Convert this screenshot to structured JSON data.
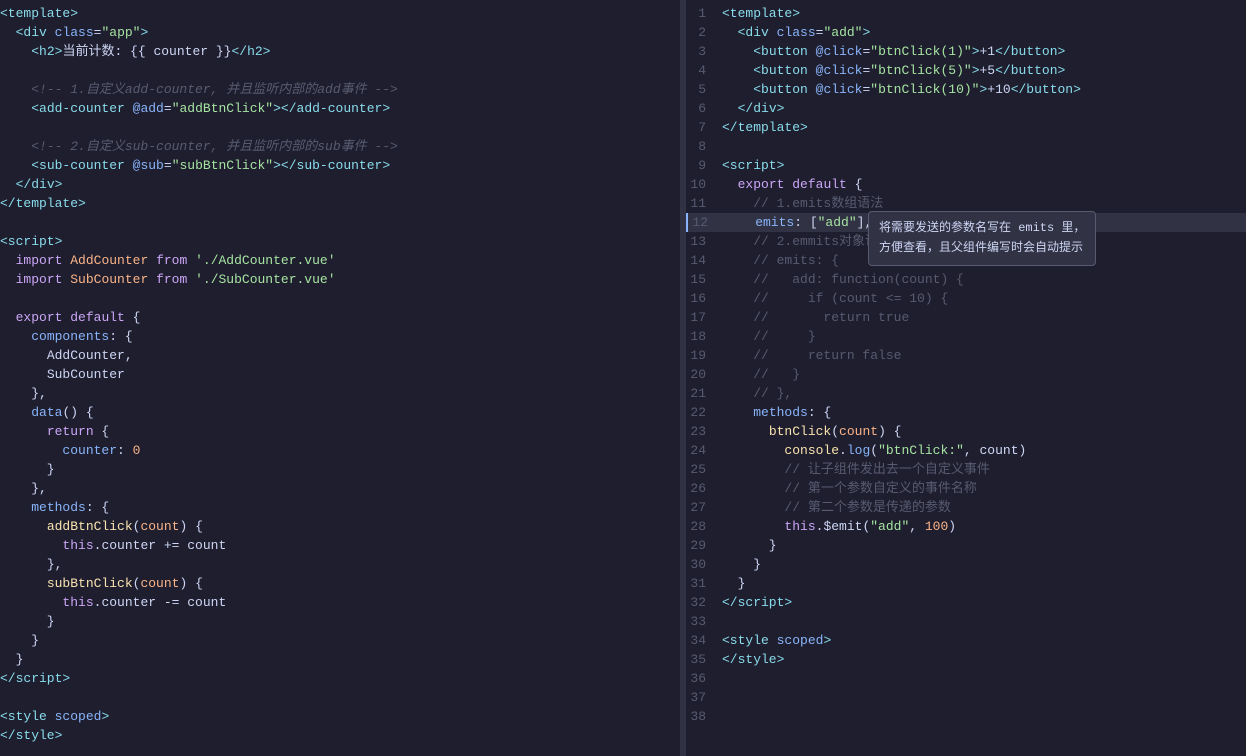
{
  "left_pane": {
    "lines": [
      {
        "num": "",
        "content": "<template>",
        "tokens": [
          {
            "t": "tag",
            "v": "<template>"
          }
        ]
      },
      {
        "num": "",
        "content": "  <div class=\"app\">",
        "tokens": [
          {
            "t": "tag",
            "v": "  <div"
          },
          {
            "t": "white",
            "v": " "
          },
          {
            "t": "attr",
            "v": "class"
          },
          {
            "t": "white",
            "v": "="
          },
          {
            "t": "string",
            "v": "\"app\""
          },
          {
            "t": "tag",
            "v": ">"
          }
        ]
      },
      {
        "num": "",
        "content": "    <h2>当前计数: {{ counter }}</h2>",
        "tokens": [
          {
            "t": "tag",
            "v": "    <h2>"
          },
          {
            "t": "white",
            "v": "当前计数: {{ counter }}"
          },
          {
            "t": "tag",
            "v": "</h2>"
          }
        ]
      },
      {
        "num": "",
        "content": "",
        "tokens": []
      },
      {
        "num": "",
        "content": "    <!-- 1.自定义add-counter, 并且监听内部的add事件 -->",
        "tokens": [
          {
            "t": "comment",
            "v": "    <!-- 1.自定义add-counter, 并且监听内部的add事件 -->"
          }
        ]
      },
      {
        "num": "",
        "content": "    <add-counter @add=\"addBtnClick\"></add-counter>",
        "tokens": [
          {
            "t": "tag",
            "v": "    <add-counter"
          },
          {
            "t": "white",
            "v": " "
          },
          {
            "t": "attr",
            "v": "@add"
          },
          {
            "t": "white",
            "v": "="
          },
          {
            "t": "string",
            "v": "\"addBtnClick\""
          },
          {
            "t": "tag",
            "v": "></add-counter>"
          }
        ]
      },
      {
        "num": "",
        "content": "",
        "tokens": []
      },
      {
        "num": "",
        "content": "    <!-- 2.自定义sub-counter, 并且监听内部的sub事件 -->",
        "tokens": [
          {
            "t": "comment",
            "v": "    <!-- 2.自定义sub-counter, 并且监听内部的sub事件 -->"
          }
        ]
      },
      {
        "num": "",
        "content": "    <sub-counter @sub=\"subBtnClick\"></sub-counter>",
        "tokens": [
          {
            "t": "tag",
            "v": "    <sub-counter"
          },
          {
            "t": "white",
            "v": " "
          },
          {
            "t": "attr",
            "v": "@sub"
          },
          {
            "t": "white",
            "v": "="
          },
          {
            "t": "string",
            "v": "\"subBtnClick\""
          },
          {
            "t": "tag",
            "v": "></sub-counter>"
          }
        ]
      },
      {
        "num": "",
        "content": "  </div>",
        "tokens": [
          {
            "t": "tag",
            "v": "  </div>"
          }
        ]
      },
      {
        "num": "",
        "content": "</template>",
        "tokens": [
          {
            "t": "tag",
            "v": "</template>"
          }
        ]
      },
      {
        "num": "",
        "content": "",
        "tokens": []
      },
      {
        "num": "",
        "content": "<script>",
        "tokens": [
          {
            "t": "tag",
            "v": "<script>"
          }
        ]
      },
      {
        "num": "",
        "content": "  import AddCounter from './AddCounter.vue'",
        "tokens": [
          {
            "t": "keyword",
            "v": "  import"
          },
          {
            "t": "white",
            "v": " "
          },
          {
            "t": "orange",
            "v": "AddCounter"
          },
          {
            "t": "white",
            "v": " "
          },
          {
            "t": "keyword",
            "v": "from"
          },
          {
            "t": "white",
            "v": " "
          },
          {
            "t": "string",
            "v": "'./AddCounter.vue'"
          }
        ]
      },
      {
        "num": "",
        "content": "  import SubCounter from './SubCounter.vue'",
        "tokens": [
          {
            "t": "keyword",
            "v": "  import"
          },
          {
            "t": "white",
            "v": " "
          },
          {
            "t": "orange",
            "v": "SubCounter"
          },
          {
            "t": "white",
            "v": " "
          },
          {
            "t": "keyword",
            "v": "from"
          },
          {
            "t": "white",
            "v": " "
          },
          {
            "t": "string",
            "v": "'./SubCounter.vue'"
          }
        ]
      },
      {
        "num": "",
        "content": "",
        "tokens": []
      },
      {
        "num": "",
        "content": "  export default {",
        "tokens": [
          {
            "t": "keyword",
            "v": "  export"
          },
          {
            "t": "white",
            "v": " "
          },
          {
            "t": "keyword",
            "v": "default"
          },
          {
            "t": "white",
            "v": " {"
          }
        ]
      },
      {
        "num": "",
        "content": "    components: {",
        "tokens": [
          {
            "t": "blue",
            "v": "    components"
          },
          {
            "t": "white",
            "v": ": {"
          }
        ]
      },
      {
        "num": "",
        "content": "      AddCounter,",
        "tokens": [
          {
            "t": "white",
            "v": "      AddCounter,"
          }
        ]
      },
      {
        "num": "",
        "content": "      SubCounter",
        "tokens": [
          {
            "t": "white",
            "v": "      SubCounter"
          }
        ]
      },
      {
        "num": "",
        "content": "    },",
        "tokens": [
          {
            "t": "white",
            "v": "    },"
          }
        ]
      },
      {
        "num": "",
        "content": "    data() {",
        "tokens": [
          {
            "t": "blue",
            "v": "    data"
          },
          {
            "t": "white",
            "v": "() {"
          }
        ]
      },
      {
        "num": "",
        "content": "      return {",
        "tokens": [
          {
            "t": "keyword",
            "v": "      return"
          },
          {
            "t": "white",
            "v": " {"
          }
        ]
      },
      {
        "num": "",
        "content": "        counter: 0",
        "tokens": [
          {
            "t": "blue",
            "v": "        counter"
          },
          {
            "t": "white",
            "v": ": "
          },
          {
            "t": "number",
            "v": "0"
          }
        ]
      },
      {
        "num": "",
        "content": "      }",
        "tokens": [
          {
            "t": "white",
            "v": "      }"
          }
        ]
      },
      {
        "num": "",
        "content": "    },",
        "tokens": [
          {
            "t": "white",
            "v": "    },"
          }
        ]
      },
      {
        "num": "",
        "content": "    methods: {",
        "tokens": [
          {
            "t": "blue",
            "v": "    methods"
          },
          {
            "t": "white",
            "v": ": {"
          }
        ]
      },
      {
        "num": "",
        "content": "      addBtnClick(count) {",
        "tokens": [
          {
            "t": "yellow",
            "v": "      addBtnClick"
          },
          {
            "t": "white",
            "v": "("
          },
          {
            "t": "orange",
            "v": "count"
          },
          {
            "t": "white",
            "v": ") {"
          }
        ]
      },
      {
        "num": "",
        "content": "        this.counter += count",
        "tokens": [
          {
            "t": "keyword",
            "v": "        this"
          },
          {
            "t": "white",
            "v": ".counter += count"
          }
        ]
      },
      {
        "num": "",
        "content": "      },",
        "tokens": [
          {
            "t": "white",
            "v": "      },"
          }
        ]
      },
      {
        "num": "",
        "content": "      subBtnClick(count) {",
        "tokens": [
          {
            "t": "yellow",
            "v": "      subBtnClick"
          },
          {
            "t": "white",
            "v": "("
          },
          {
            "t": "orange",
            "v": "count"
          },
          {
            "t": "white",
            "v": ") {"
          }
        ]
      },
      {
        "num": "",
        "content": "        this.counter -= count",
        "tokens": [
          {
            "t": "keyword",
            "v": "        this"
          },
          {
            "t": "white",
            "v": ".counter -= count"
          }
        ]
      },
      {
        "num": "",
        "content": "      }",
        "tokens": [
          {
            "t": "white",
            "v": "      }"
          }
        ]
      },
      {
        "num": "",
        "content": "    }",
        "tokens": [
          {
            "t": "white",
            "v": "    }"
          }
        ]
      },
      {
        "num": "",
        "content": "  }",
        "tokens": [
          {
            "t": "white",
            "v": "  }"
          }
        ]
      },
      {
        "num": "",
        "content": "</script>",
        "tokens": [
          {
            "t": "tag",
            "v": "</script>"
          }
        ]
      },
      {
        "num": "",
        "content": "",
        "tokens": []
      },
      {
        "num": "",
        "content": "<style scoped>",
        "tokens": [
          {
            "t": "tag",
            "v": "<style"
          },
          {
            "t": "white",
            "v": " "
          },
          {
            "t": "attr",
            "v": "scoped"
          },
          {
            "t": "tag",
            "v": ">"
          }
        ]
      },
      {
        "num": "",
        "content": "</style>",
        "tokens": [
          {
            "t": "tag",
            "v": "</style>"
          }
        ]
      }
    ]
  },
  "right_pane": {
    "lines": [
      {
        "num": "1",
        "content": "<template>",
        "highlight": false
      },
      {
        "num": "2",
        "content": "  <div class=\"add\">",
        "highlight": false
      },
      {
        "num": "3",
        "content": "    <button @click=\"btnClick(1)\">+1</button>",
        "highlight": false
      },
      {
        "num": "4",
        "content": "    <button @click=\"btnClick(5)\">+5</button>",
        "highlight": false
      },
      {
        "num": "5",
        "content": "    <button @click=\"btnClick(10)\">+10</button>",
        "highlight": false
      },
      {
        "num": "6",
        "content": "  </div>",
        "highlight": false
      },
      {
        "num": "7",
        "content": "</template>",
        "highlight": false
      },
      {
        "num": "8",
        "content": "",
        "highlight": false
      },
      {
        "num": "9",
        "content": "<script>",
        "highlight": false
      },
      {
        "num": "10",
        "content": "  export default {",
        "highlight": false
      },
      {
        "num": "11",
        "content": "    // 1.emits数组语法",
        "highlight": false
      },
      {
        "num": "12",
        "content": "    emits: [\"add\"],",
        "highlight": true
      },
      {
        "num": "13",
        "content": "    // 2.emmits对象语法",
        "highlight": false
      },
      {
        "num": "14",
        "content": "    // emits: {",
        "highlight": false
      },
      {
        "num": "15",
        "content": "    //   add: function(count) {",
        "highlight": false
      },
      {
        "num": "16",
        "content": "    //     if (count <= 10) {",
        "highlight": false
      },
      {
        "num": "17",
        "content": "    //       return true",
        "highlight": false
      },
      {
        "num": "18",
        "content": "    //     }",
        "highlight": false
      },
      {
        "num": "19",
        "content": "    //     return false",
        "highlight": false
      },
      {
        "num": "20",
        "content": "    //   }",
        "highlight": false
      },
      {
        "num": "21",
        "content": "    // },",
        "highlight": false
      },
      {
        "num": "22",
        "content": "    methods: {",
        "highlight": false
      },
      {
        "num": "23",
        "content": "      btnClick(count) {",
        "highlight": false
      },
      {
        "num": "24",
        "content": "        console.log(\"btnClick:\", count)",
        "highlight": false
      },
      {
        "num": "25",
        "content": "        // 让子组件发出去一个自定义事件",
        "highlight": false
      },
      {
        "num": "26",
        "content": "        // 第一个参数自定义的事件名称",
        "highlight": false
      },
      {
        "num": "27",
        "content": "        // 第二个参数是传递的参数",
        "highlight": false
      },
      {
        "num": "28",
        "content": "        this.$emit(\"add\", 100)",
        "highlight": false
      },
      {
        "num": "29",
        "content": "      }",
        "highlight": false
      },
      {
        "num": "30",
        "content": "    }",
        "highlight": false
      },
      {
        "num": "31",
        "content": "  }",
        "highlight": false
      },
      {
        "num": "32",
        "content": "</script>",
        "highlight": false
      },
      {
        "num": "33",
        "content": "",
        "highlight": false
      },
      {
        "num": "34",
        "content": "<style scoped>",
        "highlight": false
      },
      {
        "num": "35",
        "content": "</style>",
        "highlight": false
      },
      {
        "num": "36",
        "content": "",
        "highlight": false
      },
      {
        "num": "37",
        "content": "",
        "highlight": false
      },
      {
        "num": "38",
        "content": "",
        "highlight": false
      }
    ],
    "tooltip": {
      "text": "将需要发送的参数名写在 emits 里，\n方便查看，且父组件编写时会自动提示",
      "line": 12
    }
  }
}
